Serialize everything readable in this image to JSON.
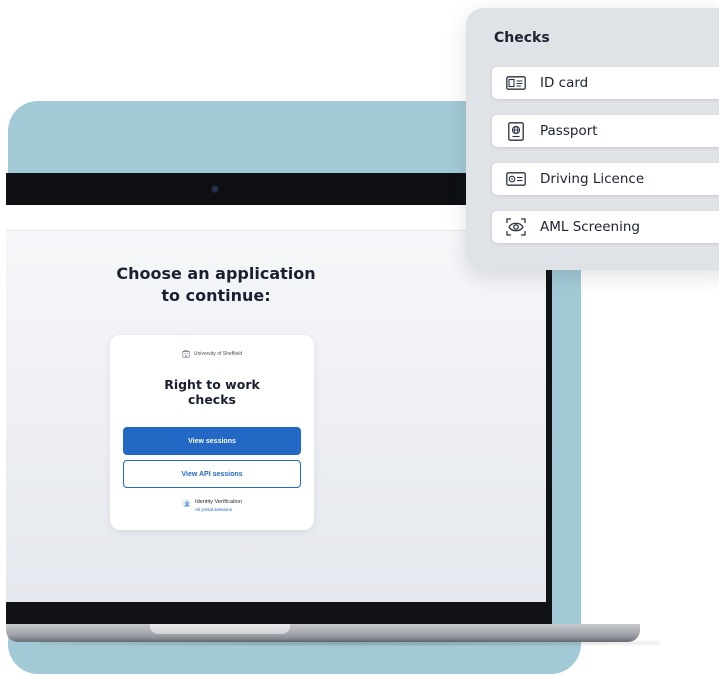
{
  "screen": {
    "heading": "Choose an application\nto continue:",
    "card": {
      "organisation": "University of Sheffield",
      "title": "Right to work\nchecks",
      "primary_button": "View sessions",
      "secondary_button": "View API sessions",
      "identity_label": "Identity Verification",
      "identity_sub": "Ali portal sessions"
    }
  },
  "checks": {
    "title": "Checks",
    "items": [
      {
        "label": "ID card",
        "icon": "id-card-icon"
      },
      {
        "label": "Passport",
        "icon": "passport-icon"
      },
      {
        "label": "Driving Licence",
        "icon": "driving-licence-icon"
      },
      {
        "label": "AML Screening",
        "icon": "aml-screening-icon"
      }
    ]
  },
  "colors": {
    "accent": "#2268c4",
    "backdrop": "#a2cad6",
    "panel": "#dfe2e7"
  }
}
